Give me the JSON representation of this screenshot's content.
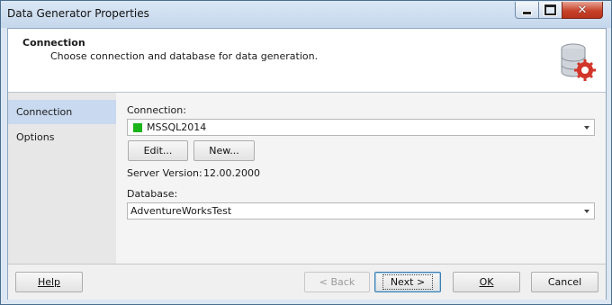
{
  "window": {
    "title": "Data Generator Properties"
  },
  "header": {
    "title": "Connection",
    "description": "Choose connection and database for data generation.",
    "icon": "database-settings-icon"
  },
  "sidebar": {
    "items": [
      {
        "label": "Connection",
        "active": true
      },
      {
        "label": "Options",
        "active": false
      }
    ]
  },
  "form": {
    "connection_label": "Connection:",
    "connection_value": "MSSQL2014",
    "connection_color": "#1bb41b",
    "edit_label": "Edit...",
    "new_label": "New...",
    "server_version_label": "Server Version:",
    "server_version_value": "12.00.2000",
    "database_label": "Database:",
    "database_value": "AdventureWorksTest"
  },
  "footer": {
    "help_label": "Help",
    "back_label": "< Back",
    "next_label": "Next >",
    "ok_label": "OK",
    "cancel_label": "Cancel"
  },
  "colors": {
    "titlebar": "#c5d7ec",
    "selected_nav": "#c9d9ef",
    "close_button": "#c7422b"
  }
}
